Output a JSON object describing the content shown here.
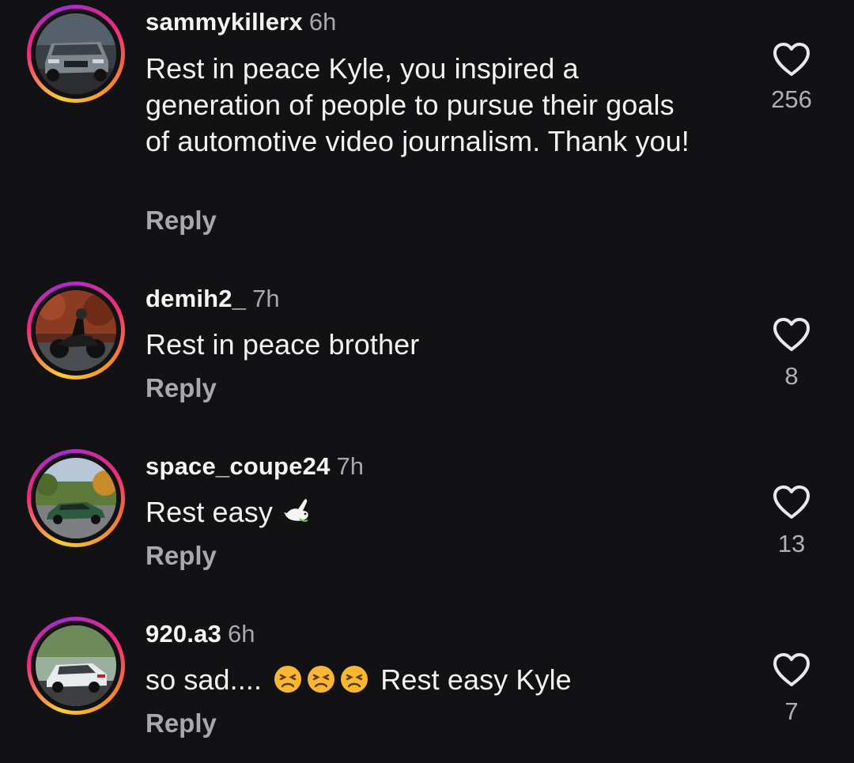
{
  "comments": [
    {
      "username": "sammykillerx",
      "time": "6h",
      "text": "Rest in peace Kyle, you inspired a generation of people to pursue their goals of automotive video journalism. Thank you!",
      "reply_label": "Reply",
      "likes": "256",
      "avatar_icon": "gray-car-avatar"
    },
    {
      "username": "demih2_",
      "time": "7h",
      "text": "Rest in peace brother",
      "reply_label": "Reply",
      "likes": "8",
      "avatar_icon": "motorcycle-rider-avatar"
    },
    {
      "username": "space_coupe24",
      "time": "7h",
      "text": "Rest easy",
      "text_emoji": "dove-icon",
      "reply_label": "Reply",
      "likes": "13",
      "avatar_icon": "green-coupe-avatar"
    },
    {
      "username": "920.a3",
      "time": "6h",
      "text_before": "so sad....",
      "text_emojis": [
        "tired-face-icon",
        "tired-face-icon",
        "tired-face-icon"
      ],
      "text_after": "Rest easy Kyle",
      "reply_label": "Reply",
      "likes": "7",
      "avatar_icon": "white-sedan-avatar"
    }
  ],
  "colors": {
    "background": "#121215",
    "primary_text": "#f3f3f3",
    "secondary_text": "#a8a8ad",
    "story_ring": [
      "#f9ce34",
      "#ee2a7b",
      "#a52bd1"
    ]
  }
}
